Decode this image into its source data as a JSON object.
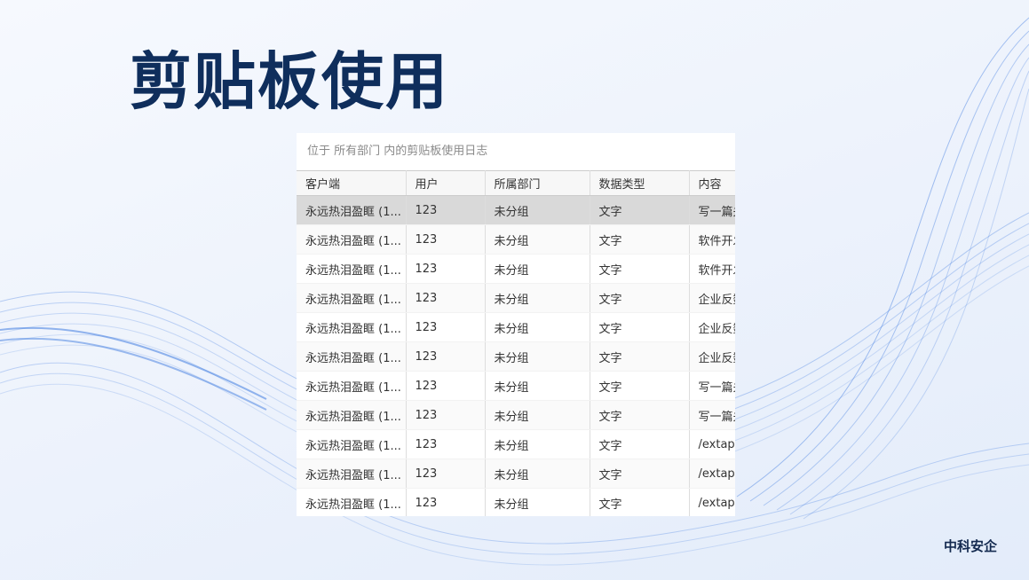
{
  "slide": {
    "title": "剪贴板使用",
    "brand": "中科安企"
  },
  "log_panel": {
    "caption": "位于 所有部门 内的剪贴板使用日志",
    "columns": [
      "客户端",
      "用户",
      "所属部门",
      "数据类型",
      "内容"
    ],
    "selected_row_index": 0,
    "rows": [
      [
        "永远热泪盈眶 (1...",
        "123",
        "未分组",
        "文字",
        "写一篇关"
      ],
      [
        "永远热泪盈眶 (1...",
        "123",
        "未分组",
        "文字",
        "软件开发"
      ],
      [
        "永远热泪盈眶 (1...",
        "123",
        "未分组",
        "文字",
        "软件开发"
      ],
      [
        "永远热泪盈眶 (1...",
        "123",
        "未分组",
        "文字",
        "企业反数"
      ],
      [
        "永远热泪盈眶 (1...",
        "123",
        "未分组",
        "文字",
        "企业反数"
      ],
      [
        "永远热泪盈眶 (1...",
        "123",
        "未分组",
        "文字",
        "企业反数"
      ],
      [
        "永远热泪盈眶 (1...",
        "123",
        "未分组",
        "文字",
        "写一篇关"
      ],
      [
        "永远热泪盈眶 (1...",
        "123",
        "未分组",
        "文字",
        "写一篇关"
      ],
      [
        "永远热泪盈眶 (1...",
        "123",
        "未分组",
        "文字",
        "/extapi/"
      ],
      [
        "永远热泪盈眶 (1...",
        "123",
        "未分组",
        "文字",
        "/extapi/"
      ],
      [
        "永远热泪盈眶 (1...",
        "123",
        "未分组",
        "文字",
        "/extapi/"
      ]
    ]
  },
  "colors": {
    "title": "#0f2e5c",
    "accent_wave": "#3f7be0",
    "selected_row": "#d9d9d9"
  }
}
